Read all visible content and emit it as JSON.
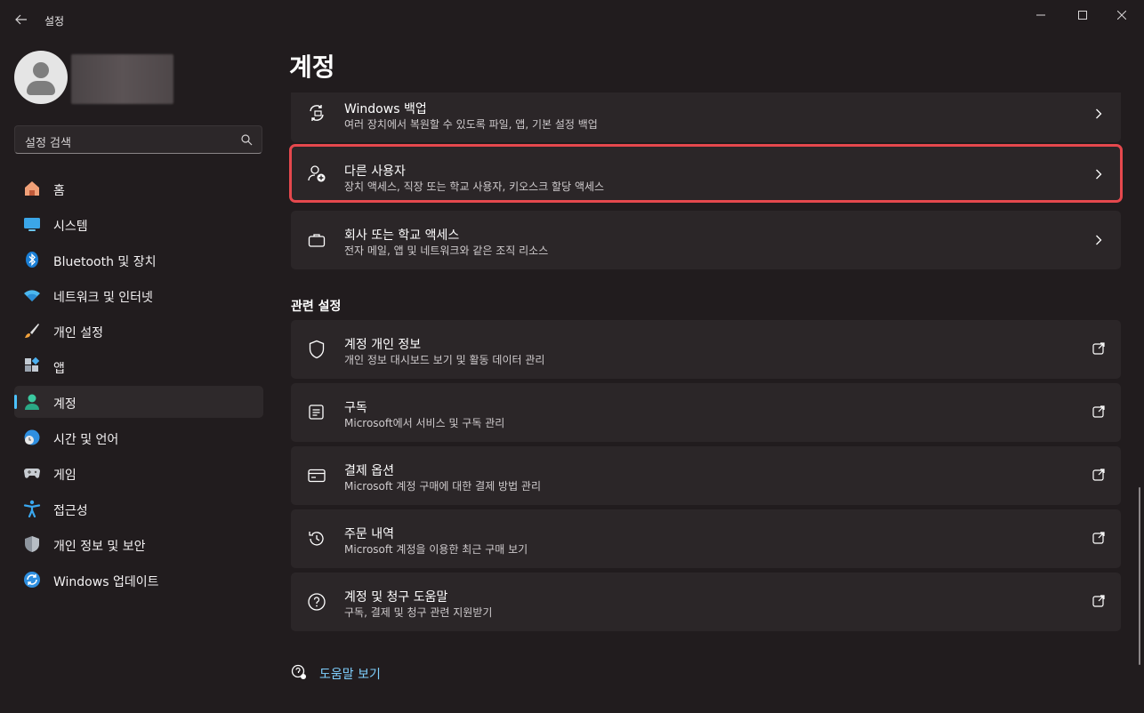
{
  "window": {
    "app_title": "설정"
  },
  "sidebar": {
    "search_placeholder": "설정 검색",
    "items": [
      {
        "label": "홈",
        "icon": "home-icon"
      },
      {
        "label": "시스템",
        "icon": "system-icon"
      },
      {
        "label": "Bluetooth 및 장치",
        "icon": "bluetooth-icon"
      },
      {
        "label": "네트워크 및 인터넷",
        "icon": "wifi-icon"
      },
      {
        "label": "개인 설정",
        "icon": "brush-icon"
      },
      {
        "label": "앱",
        "icon": "apps-icon"
      },
      {
        "label": "계정",
        "icon": "account-icon",
        "active": true
      },
      {
        "label": "시간 및 언어",
        "icon": "globe-clock-icon"
      },
      {
        "label": "게임",
        "icon": "gamepad-icon"
      },
      {
        "label": "접근성",
        "icon": "accessibility-icon"
      },
      {
        "label": "개인 정보 및 보안",
        "icon": "shield-icon"
      },
      {
        "label": "Windows 업데이트",
        "icon": "update-icon"
      }
    ]
  },
  "main": {
    "page_title": "계정",
    "cards": [
      {
        "title": "Windows 백업",
        "subtitle": "여러 장치에서 복원할 수 있도록 파일, 앱, 기본 설정 백업",
        "icon": "backup-icon",
        "action": "chevron-right-icon"
      },
      {
        "title": "다른 사용자",
        "subtitle": "장치 액세스, 직장 또는 학교 사용자, 키오스크 할당 액세스",
        "icon": "add-user-icon",
        "action": "chevron-right-icon",
        "highlighted": true
      },
      {
        "title": "회사 또는 학교 액세스",
        "subtitle": "전자 메일, 앱 및 네트워크와 같은 조직 리소스",
        "icon": "briefcase-icon",
        "action": "chevron-right-icon"
      }
    ],
    "related_title": "관련 설정",
    "related": [
      {
        "title": "계정 개인 정보",
        "subtitle": "개인 정보 대시보드 보기 및 활동 데이터 관리",
        "icon": "shield-outline-icon",
        "action": "external-link-icon"
      },
      {
        "title": "구독",
        "subtitle": "Microsoft에서 서비스 및 구독 관리",
        "icon": "subscription-icon",
        "action": "external-link-icon"
      },
      {
        "title": "결제 옵션",
        "subtitle": "Microsoft 계정 구매에 대한 결제 방법 관리",
        "icon": "credit-card-icon",
        "action": "external-link-icon"
      },
      {
        "title": "주문 내역",
        "subtitle": "Microsoft 계정을 이용한 최근 구매 보기",
        "icon": "history-icon",
        "action": "external-link-icon"
      },
      {
        "title": "계정 및 청구 도움말",
        "subtitle": "구독, 결제 및 청구 관련 지원받기",
        "icon": "help-icon",
        "action": "external-link-icon"
      }
    ],
    "help_link": "도움말 보기"
  },
  "colors": {
    "background": "#211c1e",
    "card": "#2b2628",
    "accent": "#4cc2ff",
    "highlight_border": "#e5484d"
  }
}
